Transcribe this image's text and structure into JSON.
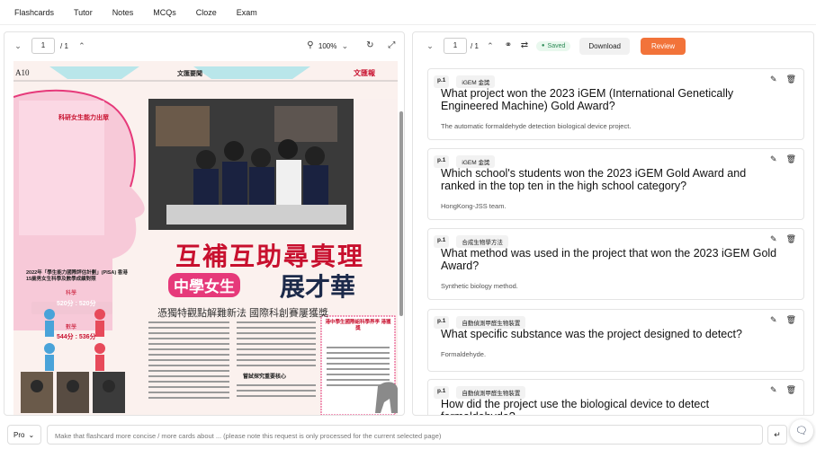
{
  "nav": {
    "items": [
      "Flashcards",
      "Tutor",
      "Notes",
      "MCQs",
      "Cloze",
      "Exam"
    ]
  },
  "left_toolbar": {
    "page": "1",
    "total": "/ 1",
    "zoom": "100%"
  },
  "newspaper": {
    "page_code": "A10",
    "header_center": "文匯要聞",
    "masthead": "文匯報",
    "headline": "互補互助尋真理",
    "sub_headline_left": "中學女生",
    "sub_headline_right": "展才華",
    "deck": "憑獨特觀點解難新法 國際科創賽屢獲獎",
    "sidebar_title": "科研女生能力出眾",
    "pisa_title": "2022年「學生能力國際評估計劃」(PISA) 香港15歲男女生科學及數學成績對照",
    "science_label": "科學",
    "science_scores": "520分 : 520分",
    "math_label": "數學",
    "math_scores": "544分 : 536分",
    "box_title": "港中學生國際組科學界李 港獲獎",
    "sub_heading": "嘗試探究重要核心"
  },
  "right_toolbar": {
    "page": "1",
    "total": "/ 1",
    "saved": "Saved",
    "download": "Download",
    "review": "Review"
  },
  "cards": [
    {
      "page": "p.1",
      "tag": "iGEM 金獎",
      "question": "What project won the 2023 iGEM (International Genetically Engineered Machine) Gold Award?",
      "answer": "The automatic formaldehyde detection biological device project."
    },
    {
      "page": "p.1",
      "tag": "iGEM 金獎",
      "question": "Which school's students won the 2023 iGEM Gold Award and ranked in the top ten in the high school category?",
      "answer": "HongKong-JSS team."
    },
    {
      "page": "p.1",
      "tag": "合成生物學方法",
      "question": "What method was used in the project that won the 2023 iGEM Gold Award?",
      "answer": "Synthetic biology method."
    },
    {
      "page": "p.1",
      "tag": "自動偵測甲醛生物裝置",
      "question": "What specific substance was the project designed to detect?",
      "answer": "Formaldehyde."
    },
    {
      "page": "p.1",
      "tag": "自動偵測甲醛生物裝置",
      "question": "How did the project use the biological device to detect formaldehyde?",
      "answer": ""
    }
  ],
  "bottom": {
    "mode": "Pro",
    "placeholder": "Make that flashcard more concise / more cards about ... (please note this request is only processed for the current selected page)"
  },
  "colors": {
    "accent": "#f2733a",
    "saved_green": "#2e8b57",
    "headline_red": "#c8102e",
    "headline_pink": "#e6397a"
  }
}
